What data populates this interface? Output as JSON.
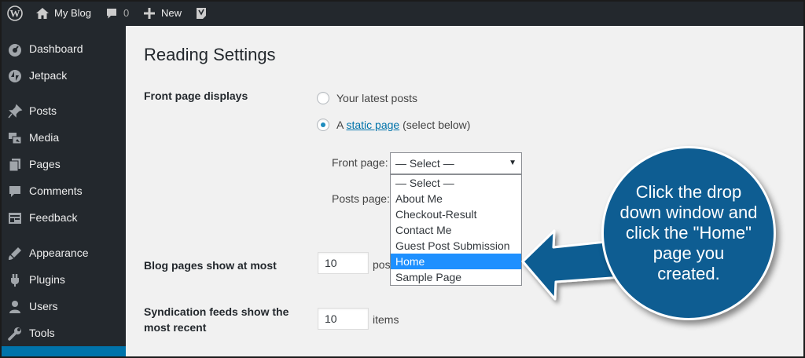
{
  "adminbar": {
    "site_name": "My Blog",
    "comment_count": "0",
    "new_label": "New"
  },
  "sidebar": {
    "items": [
      {
        "label": "Dashboard",
        "icon": "dashboard-icon"
      },
      {
        "label": "Jetpack",
        "icon": "jetpack-icon"
      },
      {
        "label": "Posts",
        "icon": "pin-icon"
      },
      {
        "label": "Media",
        "icon": "media-icon"
      },
      {
        "label": "Pages",
        "icon": "pages-icon"
      },
      {
        "label": "Comments",
        "icon": "comments-icon"
      },
      {
        "label": "Feedback",
        "icon": "feedback-icon"
      },
      {
        "label": "Appearance",
        "icon": "appearance-icon"
      },
      {
        "label": "Plugins",
        "icon": "plugins-icon"
      },
      {
        "label": "Users",
        "icon": "users-icon"
      },
      {
        "label": "Tools",
        "icon": "tools-icon"
      }
    ]
  },
  "main": {
    "title": "Reading Settings",
    "front_page_displays": {
      "label": "Front page displays",
      "option_latest": "Your latest posts",
      "option_static_prefix": "A",
      "option_static_link": "static page",
      "option_static_suffix": "(select below)",
      "front_page_label": "Front page:",
      "posts_page_label": "Posts page:",
      "selected_value": "— Select —",
      "dropdown_options": [
        "— Select —",
        "About Me",
        "Checkout-Result",
        "Contact Me",
        "Guest Post Submission",
        "Home",
        "Sample Page"
      ],
      "highlighted_option": "Home"
    },
    "blog_pages": {
      "label": "Blog pages show at most",
      "value": "10",
      "suffix": "pos"
    },
    "syndication": {
      "label_line1": "Syndication feeds show the",
      "label_line2": "most recent",
      "value": "10",
      "suffix": "items"
    }
  },
  "callout": {
    "lines": [
      "Click the drop",
      "down window and",
      "click the \"Home\"",
      "page you",
      "created."
    ],
    "color": "#0e5d92"
  },
  "colors": {
    "adminbar_bg": "#23282d",
    "highlight": "#1e90ff",
    "link": "#0073aa"
  }
}
